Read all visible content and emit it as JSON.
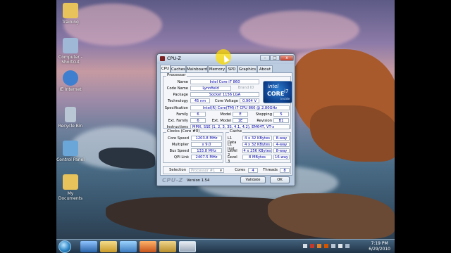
{
  "desktop": {
    "icons": [
      {
        "label": "Training",
        "color": "#e8c25a"
      },
      {
        "label": "Computer - Shortcut",
        "color": "#9fb8d6"
      },
      {
        "label": "IE Internet",
        "color": "#3f7fd0"
      },
      {
        "label": "Recycle Bin",
        "color": "#b9c6d4"
      },
      {
        "label": "Control Panel",
        "color": "#6aa6d8"
      },
      {
        "label": "My Documents",
        "color": "#e8c25a"
      }
    ]
  },
  "taskbar": {
    "clock_time": "7:19 PM",
    "clock_date": "6/29/2010"
  },
  "window": {
    "title": "CPU-Z",
    "minimize": "–",
    "maximize": "□",
    "close": "x"
  },
  "tabs": [
    "CPU",
    "Caches",
    "Mainboard",
    "Memory",
    "SPD",
    "Graphics",
    "About"
  ],
  "processor": {
    "group_title": "Processor",
    "name_label": "Name",
    "name": "Intel Core i7 860",
    "codename_label": "Code Name",
    "codename": "Lynnfield",
    "brand_id": "Brand ID",
    "package_label": "Package",
    "package": "Socket 1156 LGA",
    "technology_label": "Technology",
    "technology": "45 nm",
    "core_voltage_label": "Core Voltage",
    "core_voltage": "0.904 V",
    "spec_label": "Specification",
    "spec": "Intel(R) Core(TM) i7 CPU       860  @ 2.80GHz",
    "family_label": "Family",
    "family": "6",
    "model_label": "Model",
    "model": "E",
    "stepping_label": "Stepping",
    "stepping": "5",
    "ext_family_label": "Ext. Family",
    "ext_family": "6",
    "ext_model_label": "Ext. Model",
    "ext_model": "1E",
    "revision_label": "Revision",
    "revision": "B1",
    "instructions_label": "Instructions",
    "instructions": "MMX, SSE (1, 2, 3, 3S, 4.1, 4.2), EM64T, VT-x"
  },
  "intel_logo": {
    "word": "intel",
    "core": "CORE",
    "i7": "i7",
    "inside": "inside"
  },
  "clocks": {
    "group_title": "Clocks (Core #0)",
    "core_speed_label": "Core Speed",
    "core_speed": "1203.8 MHz",
    "multiplier_label": "Multiplier",
    "multiplier": "x 9.0",
    "bus_speed_label": "Bus Speed",
    "bus_speed": "133.8 MHz",
    "qpi_label": "QPI Link",
    "qpi": "2407.5 MHz"
  },
  "cache": {
    "group_title": "Cache",
    "rows": [
      {
        "label": "L1 Data",
        "size": "4 x 32 KBytes",
        "way": "8-way"
      },
      {
        "label": "L1 Inst.",
        "size": "4 x 32 KBytes",
        "way": "4-way"
      },
      {
        "label": "Level 2",
        "size": "4 x 256 KBytes",
        "way": "8-way"
      },
      {
        "label": "Level 3",
        "size": "8 MBytes",
        "way": "16-way"
      }
    ]
  },
  "selection": {
    "label": "Selection",
    "value": "Processor #1",
    "cores_label": "Cores",
    "cores": "4",
    "threads_label": "Threads",
    "threads": "8"
  },
  "footer": {
    "brand": "CPU-Z",
    "version": "Version 1.54",
    "validate": "Validate",
    "ok": "OK"
  }
}
